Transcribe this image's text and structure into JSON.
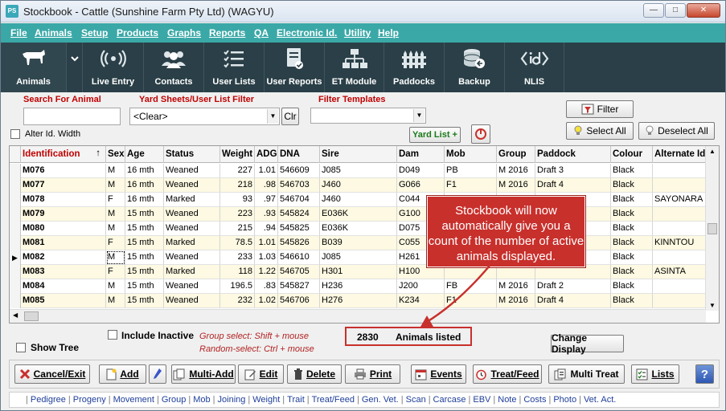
{
  "window": {
    "title": "Stockbook - Cattle (Sunshine Farm Pty Ltd) (WAGYU)",
    "app_icon": "PS"
  },
  "menu": [
    "File",
    "Animals",
    "Setup",
    "Products",
    "Graphs",
    "Reports",
    "QA",
    "Electronic Id.",
    "Utility",
    "Help"
  ],
  "toolbar": [
    {
      "label": "Animals",
      "icon": "cow-icon"
    },
    {
      "label": "Live Entry",
      "icon": "wireless-icon"
    },
    {
      "label": "Contacts",
      "icon": "people-icon"
    },
    {
      "label": "User Lists",
      "icon": "list-icon"
    },
    {
      "label": "User Reports",
      "icon": "report-icon"
    },
    {
      "label": "ET Module",
      "icon": "hierarchy-icon"
    },
    {
      "label": "Paddocks",
      "icon": "fence-icon"
    },
    {
      "label": "Backup",
      "icon": "database-icon"
    },
    {
      "label": "NLIS",
      "icon": "nlis-icon"
    }
  ],
  "filters": {
    "search_label": "Search For Animal",
    "search_value": "",
    "yard_label": "Yard Sheets/User List Filter",
    "yard_value": "<Clear>",
    "clr_label": "Clr",
    "templates_label": "Filter Templates",
    "templates_value": "",
    "alter_label": "Alter Id. Width",
    "yard_list_label": "Yard List +",
    "filter_label": "Filter",
    "select_all_label": "Select All",
    "deselect_all_label": "Deselect All"
  },
  "grid": {
    "columns": [
      "Identification",
      "Sex",
      "Age",
      "Status",
      "Weight",
      "ADG",
      "DNA",
      "Sire",
      "Dam",
      "Mob",
      "Group",
      "Paddock",
      "Colour",
      "Alternate Id."
    ],
    "sort_indicator": "↑",
    "rows": [
      [
        "M076",
        "M",
        "16 mth",
        "Weaned",
        "227",
        "1.01",
        "546609",
        "J085",
        "D049",
        "PB",
        "M 2016",
        "Draft 3",
        "Black",
        ""
      ],
      [
        "M077",
        "M",
        "16 mth",
        "Weaned",
        "218",
        ".98",
        "546703",
        "J460",
        "G066",
        "F1",
        "M 2016",
        "Draft 4",
        "Black",
        ""
      ],
      [
        "M078",
        "F",
        "16 mth",
        "Marked",
        "93",
        ".97",
        "546704",
        "J460",
        "C044",
        "",
        "",
        "",
        "Black",
        "SAYONARA"
      ],
      [
        "M079",
        "M",
        "15 mth",
        "Weaned",
        "223",
        ".93",
        "545824",
        "E036K",
        "G100",
        "",
        "",
        "",
        "Black",
        ""
      ],
      [
        "M080",
        "M",
        "15 mth",
        "Weaned",
        "215",
        ".94",
        "545825",
        "E036K",
        "D075",
        "",
        "",
        "",
        "Black",
        ""
      ],
      [
        "M081",
        "F",
        "15 mth",
        "Marked",
        "78.5",
        "1.01",
        "545826",
        "B039",
        "C055",
        "",
        "",
        "",
        "Black",
        "KINNTOU"
      ],
      [
        "M082",
        "M",
        "15 mth",
        "Weaned",
        "233",
        "1.03",
        "546610",
        "J085",
        "H261",
        "",
        "",
        "",
        "Black",
        ""
      ],
      [
        "M083",
        "F",
        "15 mth",
        "Marked",
        "118",
        "1.22",
        "546705",
        "H301",
        "H100",
        "",
        "",
        "",
        "Black",
        "ASINTA"
      ],
      [
        "M084",
        "M",
        "15 mth",
        "Weaned",
        "196.5",
        ".83",
        "545827",
        "H236",
        "J200",
        "FB",
        "M 2016",
        "Draft 2",
        "Black",
        ""
      ],
      [
        "M085",
        "M",
        "15 mth",
        "Weaned",
        "232",
        "1.02",
        "546706",
        "H276",
        "K234",
        "F1",
        "M 2016",
        "Draft 4",
        "Black",
        ""
      ]
    ],
    "current_row": 6
  },
  "options": {
    "include_inactive": "Include Inactive",
    "show_tree": "Show Tree",
    "hint_group": "Group select: Shift + mouse",
    "hint_random": "Random-select: Ctrl + mouse",
    "change_display": "Change Display"
  },
  "count": {
    "value": "2830",
    "label": "Animals listed"
  },
  "callout": {
    "text": "Stockbook will now automatically give you a count of the number of active animals displayed."
  },
  "actions": {
    "cancel": "Cancel/Exit",
    "add": "Add",
    "multi_add": "Multi-Add",
    "edit": "Edit",
    "delete": "Delete",
    "print": "Print",
    "events": "Events",
    "treat_feed": "Treat/Feed",
    "multi_treat": "Multi Treat",
    "lists": "Lists",
    "help": "?"
  },
  "links": [
    "Pedigree",
    "Progeny",
    "Movement",
    "Group",
    "Mob",
    "Joining",
    "Weight",
    "Trait",
    "Treat/Feed",
    "Gen. Vet.",
    "Scan",
    "Carcase",
    "EBV",
    "Note",
    "Costs",
    "Photo",
    "Vet. Act."
  ],
  "colors": {
    "menubar": "#3aa8a7",
    "toolbar": "#2a3f47",
    "accent_red": "#c8302c",
    "row_alt": "#fdf9e2"
  }
}
